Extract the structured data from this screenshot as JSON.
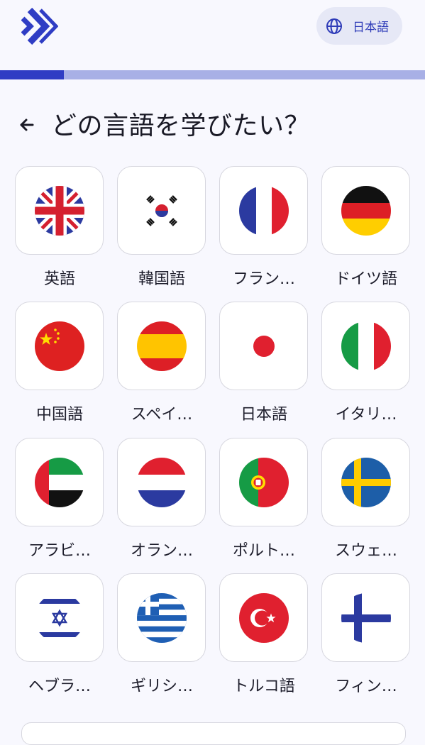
{
  "header": {
    "ui_language_label": "日本語",
    "icons": {
      "logo": "app-logo-chevrons",
      "globe": "globe-icon",
      "back": "arrow-left-icon"
    }
  },
  "progress": {
    "fraction": 0.15
  },
  "page": {
    "title": "どの言語を学びたい？"
  },
  "languages": [
    {
      "label": "英語",
      "flag": "uk-flag-icon"
    },
    {
      "label": "韓国語",
      "flag": "korea-flag-icon"
    },
    {
      "label": "フラン…",
      "flag": "france-flag-icon"
    },
    {
      "label": "ドイツ語",
      "flag": "germany-flag-icon"
    },
    {
      "label": "中国語",
      "flag": "china-flag-icon"
    },
    {
      "label": "スペイ…",
      "flag": "spain-flag-icon"
    },
    {
      "label": "日本語",
      "flag": "japan-flag-icon"
    },
    {
      "label": "イタリ…",
      "flag": "italy-flag-icon"
    },
    {
      "label": "アラビ…",
      "flag": "uae-flag-icon"
    },
    {
      "label": "オラン…",
      "flag": "netherlands-flag-icon"
    },
    {
      "label": "ポルト…",
      "flag": "portugal-flag-icon"
    },
    {
      "label": "スウェ…",
      "flag": "sweden-flag-icon"
    },
    {
      "label": "ヘブラ…",
      "flag": "israel-flag-icon"
    },
    {
      "label": "ギリシ…",
      "flag": "greece-flag-icon"
    },
    {
      "label": "トルコ語",
      "flag": "turkey-flag-icon"
    },
    {
      "label": "フィン…",
      "flag": "finland-flag-icon"
    }
  ],
  "colors": {
    "accent": "#2f3dc4",
    "progress_track": "#a8b0e6",
    "background": "#f8f8fe"
  }
}
